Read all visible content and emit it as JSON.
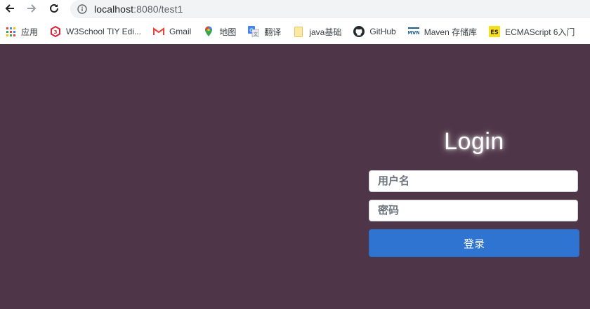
{
  "browser": {
    "url_host": "localhost",
    "url_rest": ":8080/test1",
    "bookmarks": [
      {
        "label": "应用",
        "icon": "apps-grid-icon"
      },
      {
        "label": "W3School TIY Edi...",
        "icon": "w3school-icon"
      },
      {
        "label": "Gmail",
        "icon": "gmail-icon"
      },
      {
        "label": "地图",
        "icon": "maps-pin-icon"
      },
      {
        "label": "翻译",
        "icon": "translate-icon"
      },
      {
        "label": "java基础",
        "icon": "folder-icon"
      },
      {
        "label": "GitHub",
        "icon": "github-icon"
      },
      {
        "label": "Maven 存储库",
        "icon": "maven-icon"
      },
      {
        "label": "ECMAScript 6入门",
        "icon": "es-icon"
      }
    ]
  },
  "login": {
    "title": "Login",
    "username_placeholder": "用户名",
    "password_placeholder": "密码",
    "submit_label": "登录"
  },
  "colors": {
    "page_background": "#4e3648",
    "button": "#2f74d0"
  }
}
